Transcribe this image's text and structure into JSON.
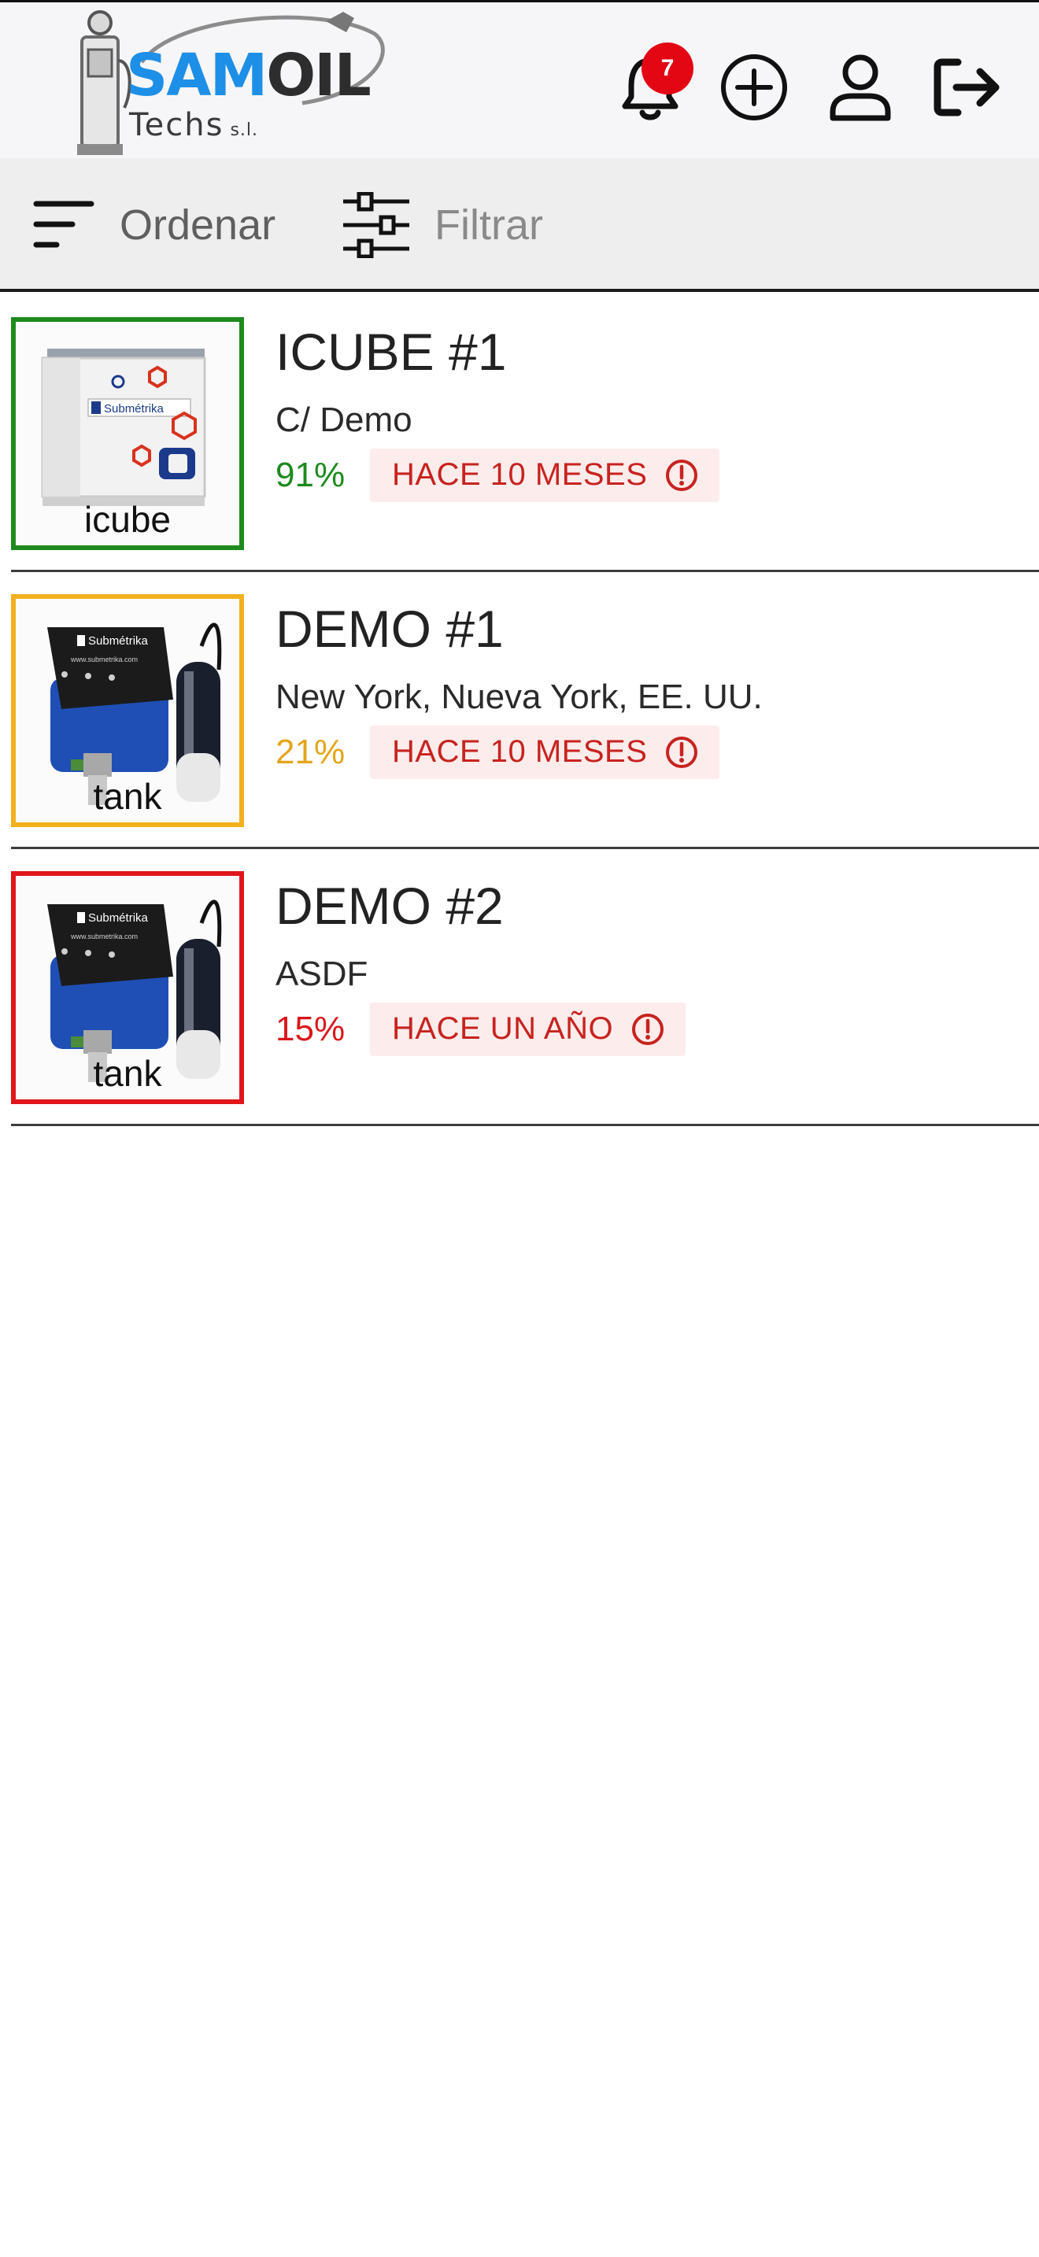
{
  "header": {
    "logo": {
      "word_sam": "SAM",
      "word_oil": "OIL",
      "sub": "Techs",
      "sub_suffix": "s.l."
    },
    "notifications_count": "7",
    "icons": [
      "bell-icon",
      "add-circle-icon",
      "user-icon",
      "logout-icon"
    ]
  },
  "toolbar": {
    "sort_label": "Ordenar",
    "filter_label": "Filtrar"
  },
  "tanks": [
    {
      "title": "ICUBE #1",
      "address": "C/ Demo",
      "level": "91%",
      "updated": "HACE 10 MESES",
      "image_caption": "icube",
      "level_color": "#1d8a1d"
    },
    {
      "title": "DEMO #1",
      "address": "New York, Nueva York, EE. UU.",
      "level": "21%",
      "updated": "HACE 10 MESES",
      "image_caption": "tank",
      "level_color": "#e3a51a"
    },
    {
      "title": "DEMO #2",
      "address": "ASDF",
      "level": "15%",
      "updated": "HACE UN AÑO",
      "image_caption": "tank",
      "level_color": "#d9161b"
    }
  ],
  "colors": {
    "alert": "#c8231f",
    "alert_bg": "#fdecec",
    "badge": "#e30613"
  }
}
